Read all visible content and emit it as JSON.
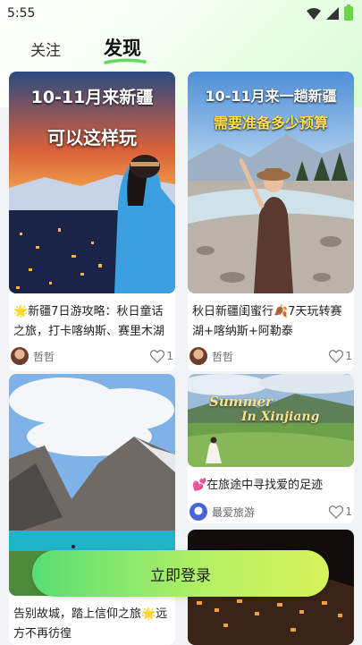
{
  "status_bar": {
    "time": "5:55"
  },
  "tabs": {
    "follow": "关注",
    "discover": "发现"
  },
  "cards": [
    {
      "overlay_line1": "10-11月来新疆",
      "overlay_line2": "可以这样玩",
      "title": "🌟新疆7日游攻略：秋日童话之旅，打卡喀纳斯、赛里木湖",
      "author": "哲哲",
      "likes": "1"
    },
    {
      "overlay_line1": "10-11月来一趟新疆",
      "overlay_line2": "需要准备多少预算",
      "title": "秋日新疆闺蜜行🍂7天玩转赛湖+喀纳斯+阿勒泰",
      "author": "哲哲",
      "likes": "1"
    },
    {
      "title": "告别故城，踏上信仰之旅🌟远方不再彷徨",
      "author": "",
      "likes": ""
    },
    {
      "overlay_line1": "Summer",
      "overlay_line2": "In Xinjiang",
      "title": "💕在旅途中寻找爱的足迹",
      "author": "最爱旅游",
      "likes": "1"
    }
  ],
  "login_button": "立即登录",
  "colors": {
    "accent_green": "#58de73",
    "accent_lime": "#d8f35c"
  }
}
